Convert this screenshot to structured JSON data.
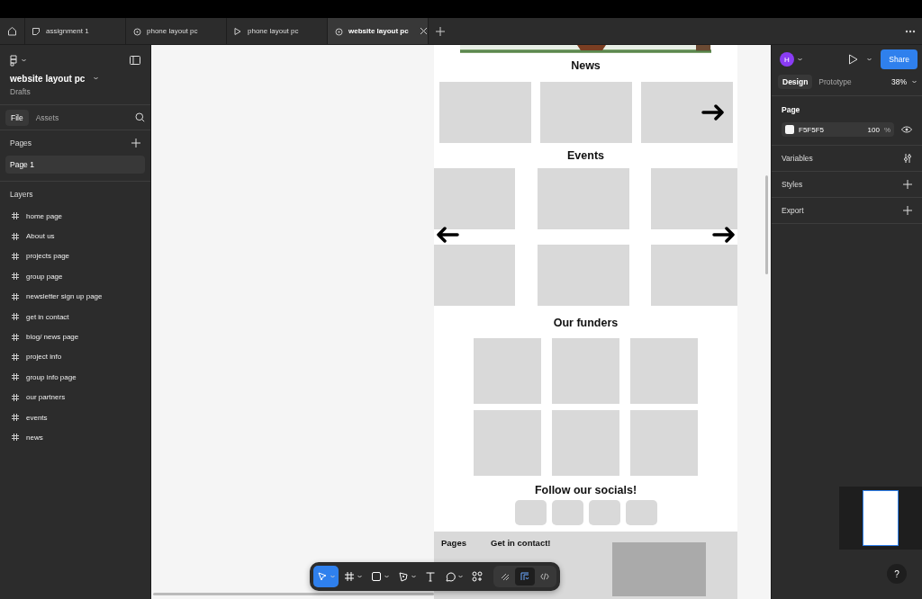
{
  "browser_tabs": [
    {
      "label": "assignment 1",
      "kind": "file",
      "selected": false
    },
    {
      "label": "phone layout pc",
      "kind": "design",
      "selected": false
    },
    {
      "label": "phone layout pc",
      "kind": "prototype",
      "selected": false
    },
    {
      "label": "website layout pc",
      "kind": "design",
      "selected": true
    }
  ],
  "file": {
    "name": "website layout pc",
    "location": "Drafts"
  },
  "panel_tabs": [
    {
      "label": "File",
      "selected": true
    },
    {
      "label": "Assets",
      "selected": false
    }
  ],
  "pages_heading": "Pages",
  "pages": [
    {
      "label": "Page 1",
      "selected": true
    }
  ],
  "layers_heading": "Layers",
  "layers": [
    "home page",
    "About us",
    "projects page",
    "group page",
    "newsletter sign up page",
    "get in contact",
    "blog/ news page",
    "project info",
    "group info page",
    "our partners",
    "events",
    "news"
  ],
  "right": {
    "avatar": "H",
    "share": "Share",
    "tabs": [
      {
        "label": "Design",
        "selected": true
      },
      {
        "label": "Prototype",
        "selected": false
      }
    ],
    "zoom": "38%",
    "page_heading": "Page",
    "page_color": "F5F5F5",
    "opacity": "100",
    "percent": "%",
    "sections": [
      {
        "label": "Variables",
        "kind": "variables"
      },
      {
        "label": "Styles",
        "kind": "add"
      },
      {
        "label": "Export",
        "kind": "add"
      }
    ]
  },
  "frame": {
    "news": {
      "title": "News",
      "cards": [
        {
          "kind": "plain"
        },
        {
          "kind": "plain"
        },
        {
          "kind": "arrow"
        }
      ]
    },
    "events": {
      "title": "Events",
      "cards": [
        {
          "kind": "plain"
        },
        {
          "kind": "plain"
        },
        {
          "kind": "plain"
        },
        {
          "kind": "plain"
        },
        {
          "kind": "plain"
        },
        {
          "kind": "plain"
        }
      ],
      "arrows": [
        {
          "kind": "left"
        },
        {
          "kind": "right"
        }
      ]
    },
    "funders": {
      "title": "Our funders",
      "cards": [
        {
          "kind": "plain"
        },
        {
          "kind": "plain"
        },
        {
          "kind": "plain"
        },
        {
          "kind": "plain"
        },
        {
          "kind": "plain"
        },
        {
          "kind": "plain"
        }
      ]
    },
    "socials": {
      "title": "Follow our socials!",
      "buttons": [
        {
          "kind": "plain"
        },
        {
          "kind": "plain"
        },
        {
          "kind": "plain"
        },
        {
          "kind": "plain"
        }
      ]
    },
    "footer": {
      "columns": [
        "Pages",
        "Get in contact!"
      ]
    }
  },
  "toolbar": {
    "tools": [
      {
        "kind": "move",
        "selected": true
      },
      {
        "kind": "frame",
        "selected": false
      },
      {
        "kind": "rectangle",
        "selected": false
      },
      {
        "kind": "pen",
        "selected": false
      },
      {
        "kind": "text",
        "selected": false
      },
      {
        "kind": "comment",
        "selected": false
      },
      {
        "kind": "actions",
        "selected": false
      }
    ],
    "modes": [
      {
        "kind": "draw",
        "selected": false
      },
      {
        "kind": "design",
        "selected": true
      },
      {
        "kind": "dev",
        "selected": false
      }
    ]
  },
  "help": "?"
}
